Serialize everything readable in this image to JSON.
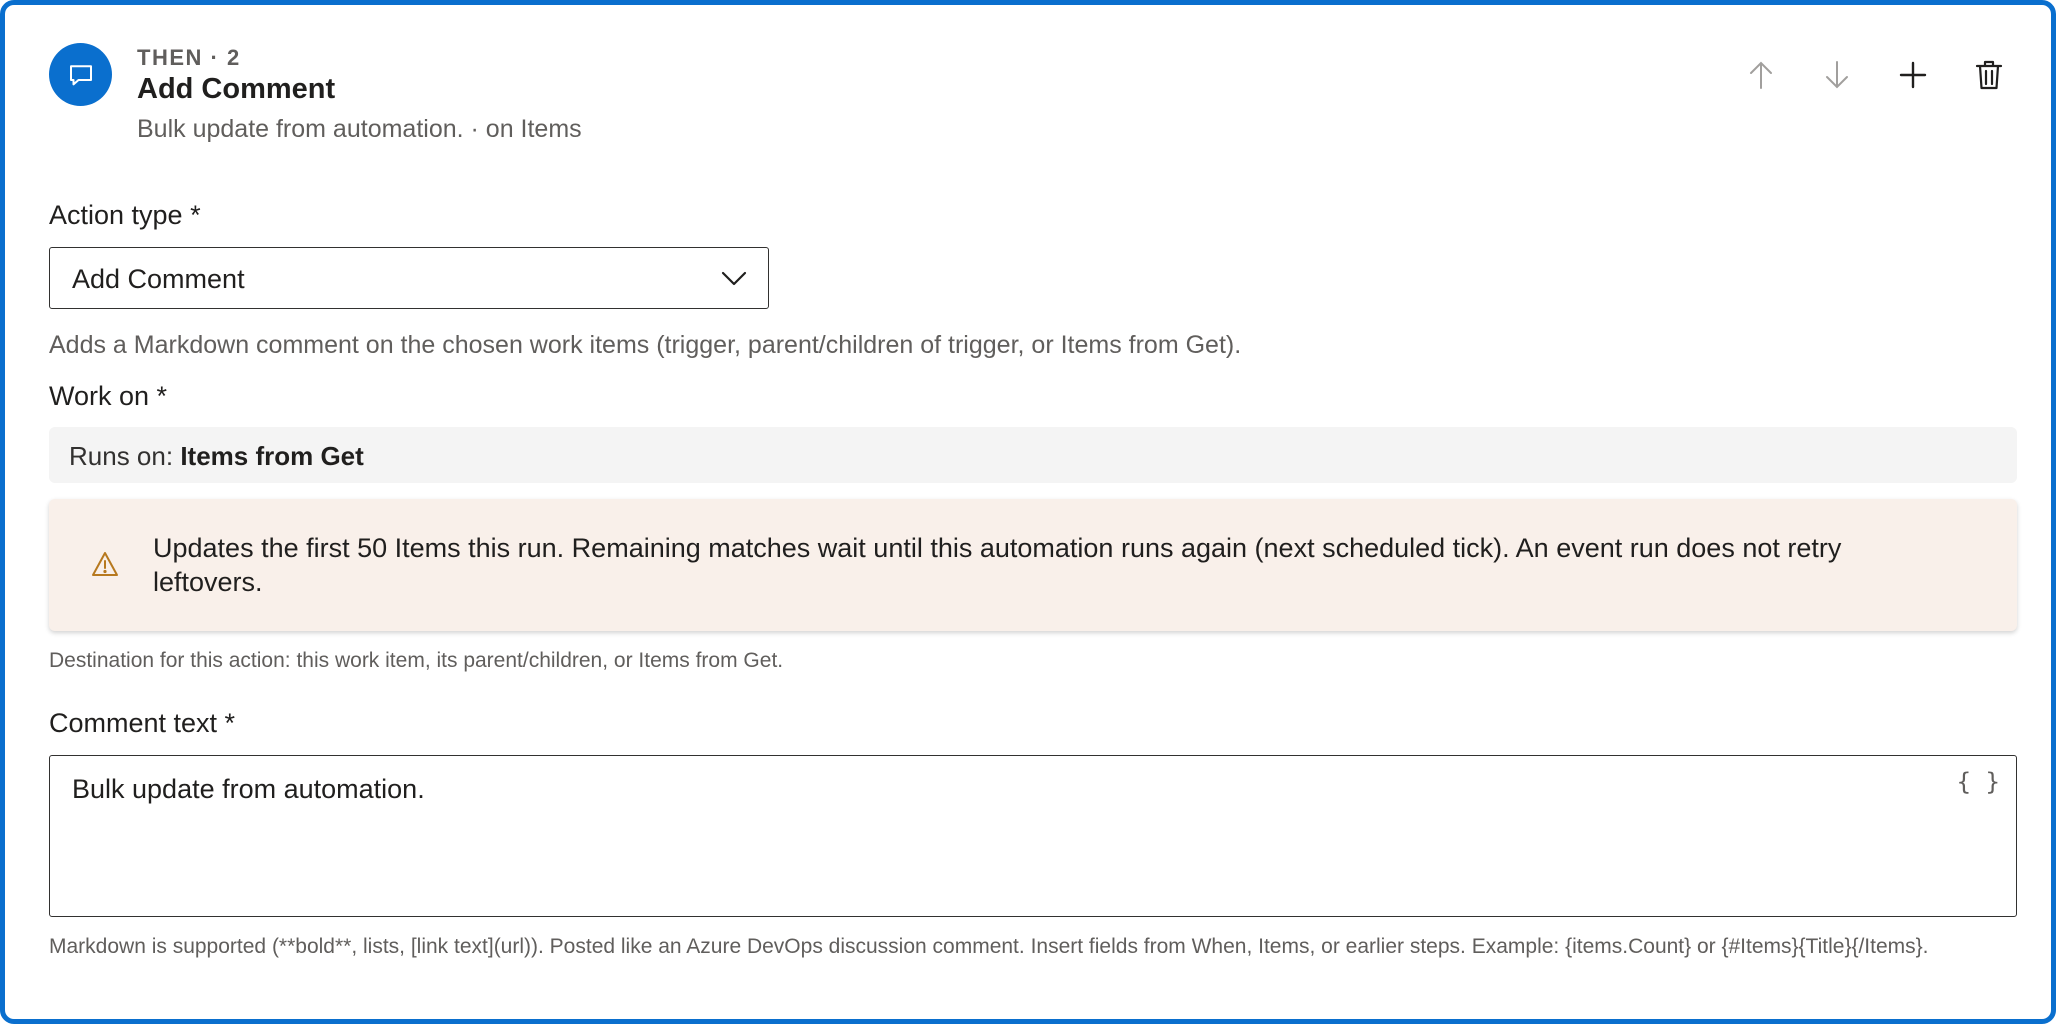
{
  "step": {
    "label": "THEN · 2",
    "title": "Add Comment",
    "subtitle": "Bulk update from automation. · on Items"
  },
  "toolbar": {
    "icons": [
      "arrow-up-icon",
      "arrow-down-icon",
      "add-icon",
      "delete-icon"
    ]
  },
  "action_type": {
    "label": "Action type *",
    "value": "Add Comment",
    "help": "Adds a Markdown comment on the chosen work items (trigger, parent/children of trigger, or Items from Get)."
  },
  "work_on": {
    "label": "Work on *",
    "runs_on_prefix": "Runs on:",
    "runs_on_value": "Items from Get",
    "warning": "Updates the first 50 Items this run. Remaining matches wait until this automation runs again (next scheduled tick). An event run does not retry leftovers.",
    "help": "Destination for this action: this work item, its parent/children, or Items from Get."
  },
  "comment": {
    "label": "Comment text *",
    "value": "Bulk update from automation.",
    "insert_icon": "{ }",
    "help": "Markdown is supported (**bold**, lists, [link text](url)). Posted like an Azure DevOps discussion comment. Insert fields from When, Items, or earlier steps. Example: {items.Count} or {#Items}{Title}{/Items}."
  },
  "colors": {
    "accent": "#0a6fce",
    "warning_bg": "#f9f0ea",
    "warning_icon": "#b7791f",
    "runs_on_bg": "#f4f4f4"
  }
}
